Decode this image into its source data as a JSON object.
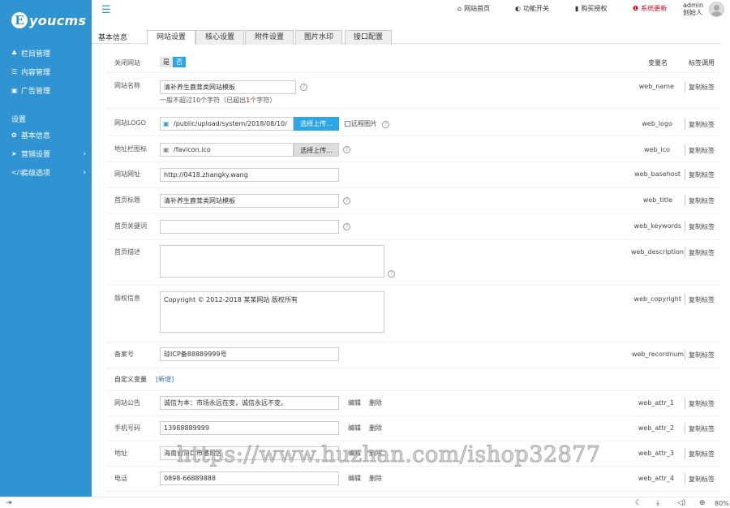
{
  "brand": {
    "logo_letter": "E",
    "logo_text": "youcms"
  },
  "sidebar": {
    "items": [
      {
        "icon": "sitemap-icon",
        "glyph": "♣",
        "label": "栏目管理"
      },
      {
        "icon": "list-icon",
        "glyph": "☰",
        "label": "内容管理"
      },
      {
        "icon": "image-icon",
        "glyph": "▣",
        "label": "广告管理"
      }
    ],
    "section": "设置",
    "settings": [
      {
        "icon": "gear-icon",
        "glyph": "✿",
        "label": "基本信息",
        "chev": ""
      },
      {
        "icon": "send-icon",
        "glyph": "➤",
        "label": "营销设置",
        "chev": "›"
      },
      {
        "icon": "code-icon",
        "glyph": "</>",
        "label": "高级选项",
        "chev": "›"
      }
    ]
  },
  "topbar": {
    "menu_glyph": "☰",
    "links": [
      {
        "glyph": "⌂",
        "label": "网站首页"
      },
      {
        "glyph": "◐",
        "label": "功能开关"
      },
      {
        "glyph": "▮",
        "label": "购买授权"
      },
      {
        "glyph": "❶",
        "label": "系统更新"
      }
    ],
    "admin_name": "admin",
    "admin_role": "创始人"
  },
  "page": {
    "section_title": "基本信息",
    "tabs": [
      "网站设置",
      "核心设置",
      "附件设置",
      "图片水印",
      "接口配置"
    ]
  },
  "header_cols": {
    "var_name": "变量名",
    "tag_call": "标签调用"
  },
  "copy_label": "复制标签",
  "close_site": {
    "label": "关闭网站",
    "yes": "是",
    "no": "否",
    "var": ""
  },
  "web_name": {
    "label": "网站名称",
    "value": "清补养生鹿茸类网站模板",
    "hint_pre": "一般不超过10个字符（已超出",
    "hint_num": "1",
    "hint_post": "个字符）",
    "var": "web_name"
  },
  "web_logo": {
    "label": "网站LOGO",
    "value": "/public/upload/system/2018/08/10/",
    "btn": "选择上传...",
    "remote": "远程图片",
    "var": "web_logo"
  },
  "web_ico": {
    "label": "地址栏图标",
    "value": "/favicon.ico",
    "btn": "选择上传...",
    "var": "web_ico"
  },
  "web_basehost": {
    "label": "网站网址",
    "value": "http://0418.zhangky.wang",
    "var": "web_basehost"
  },
  "web_title": {
    "label": "首页标题",
    "value": "清补养生鹿茸类网站模板",
    "var": "web_title"
  },
  "web_keywords": {
    "label": "首页关键词",
    "value": "",
    "var": "web_keywords"
  },
  "web_description": {
    "label": "首页描述",
    "value": "",
    "var": "web_description"
  },
  "web_copyright": {
    "label": "版权信息",
    "value": "Copyright © 2012-2018 某某网站 版权所有",
    "var": "web_copyright"
  },
  "web_recordnum": {
    "label": "备案号",
    "value": "琼ICP备88889999号",
    "var": "web_recordnum"
  },
  "custom": {
    "label": "自定义变量",
    "new_link": "[新增]"
  },
  "attrs": [
    {
      "label": "网站公告",
      "value": "诚信为本：市场永远在变，诚信永远不变。",
      "edit": "编辑",
      "del": "删除",
      "var": "web_attr_1"
    },
    {
      "label": "手机号码",
      "value": "13988889999",
      "edit": "编辑",
      "del": "删除",
      "var": "web_attr_2"
    },
    {
      "label": "地址",
      "value": "海南省海口市番禺区",
      "edit": "编辑",
      "del": "删除",
      "var": "web_attr_3"
    },
    {
      "label": "电话",
      "value": "0898-66889888",
      "edit": "编辑",
      "del": "删除",
      "var": "web_attr_4"
    }
  ],
  "watermark": "https://www.huzhan.com/ishop32877",
  "footer": {
    "zoom": "80%"
  }
}
